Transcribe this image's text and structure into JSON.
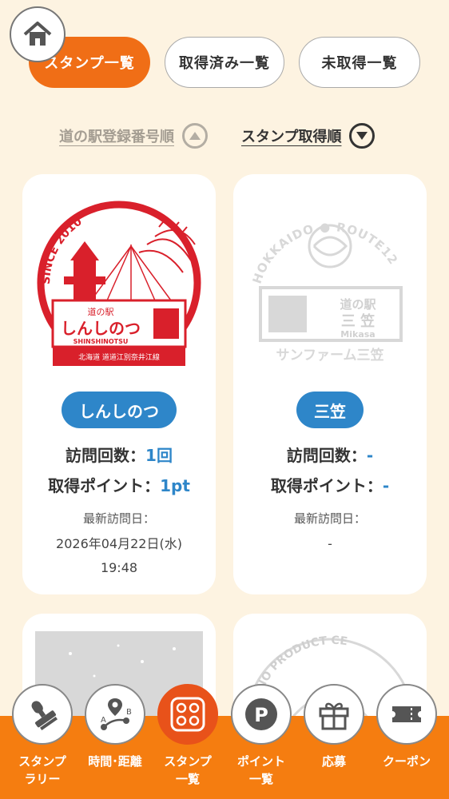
{
  "home": {
    "icon": "home-icon"
  },
  "tabs": [
    {
      "label": "スタンプ一覧",
      "active": true
    },
    {
      "label": "取得済み一覧",
      "active": false
    },
    {
      "label": "未取得一覧",
      "active": false
    }
  ],
  "sort": [
    {
      "label": "道の駅登録番号順",
      "icon": "chevron-up-icon",
      "active": false
    },
    {
      "label": "スタンプ取得順",
      "icon": "chevron-down-icon",
      "active": true
    }
  ],
  "cards": [
    {
      "name": "しんしのつ",
      "stamp_text": {
        "since": "SINCE 2010",
        "top": "道の駅",
        "main": "しんしのつ",
        "roman": "SHINSHINOTSU",
        "addr": "北海道 道道江別奈井江線"
      },
      "visits_label": "訪問回数：",
      "visits_value": "1回",
      "points_label": "取得ポイント：",
      "points_value": "1pt",
      "latest_label": "最新訪問日：",
      "latest_date": "2026年04月22日(水)",
      "latest_time": "19:48"
    },
    {
      "name": "三笠",
      "stamp_text": {
        "arc": "HOKKAIDO ● ROUTE12",
        "top": "道の駅",
        "main": "三 笠",
        "roman": "Mikasa",
        "bottom": "サンファーム三笠"
      },
      "visits_label": "訪問回数：",
      "visits_value": "-",
      "points_label": "取得ポイント：",
      "points_value": "-",
      "latest_label": "最新訪問日：",
      "latest_date": "-",
      "latest_time": ""
    },
    {
      "name": "",
      "stamp_text": {}
    },
    {
      "name": "",
      "stamp_text": {
        "arc": "FURANO PRODUCT CE"
      }
    }
  ],
  "bottom_nav": [
    {
      "label": "スタンプ\nラリー",
      "icon": "stamp-icon",
      "active": false
    },
    {
      "label": "時間･距離",
      "icon": "route-icon",
      "active": false
    },
    {
      "label": "スタンプ\n一覧",
      "icon": "grid-icon",
      "active": true
    },
    {
      "label": "ポイント\n一覧",
      "icon": "points-icon",
      "active": false
    },
    {
      "label": "応募",
      "icon": "gift-icon",
      "active": false
    },
    {
      "label": "クーポン",
      "icon": "coupon-icon",
      "active": false
    }
  ],
  "colors": {
    "accent": "#f06e16",
    "blue": "#2e86c9",
    "stamp_red": "#d9202b",
    "background": "#fdf3e1"
  }
}
